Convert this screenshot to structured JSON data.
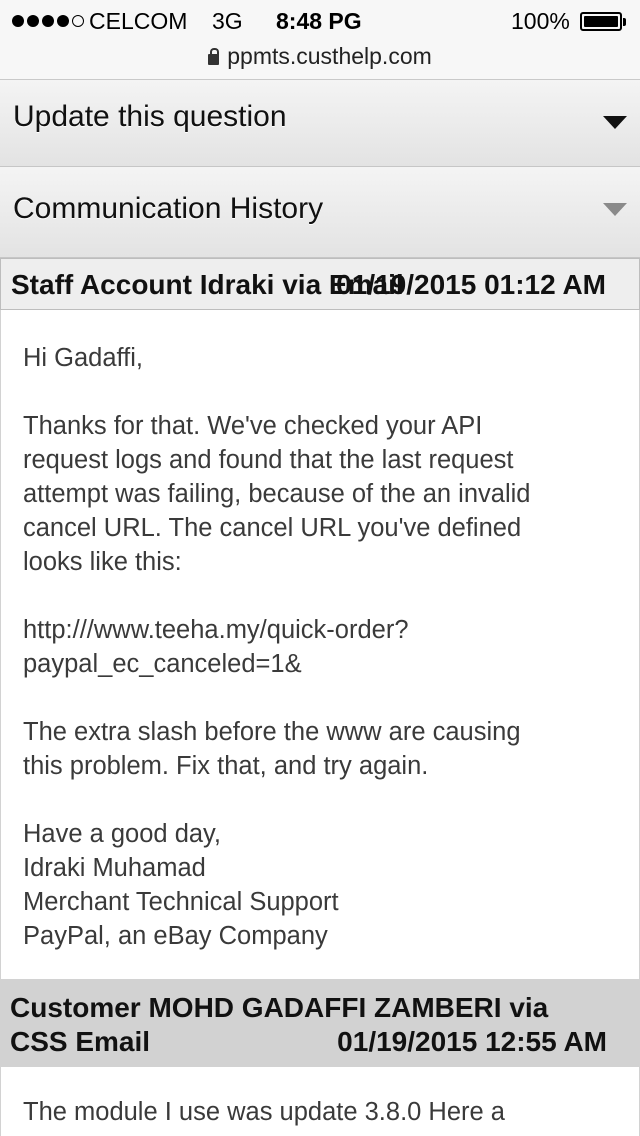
{
  "status_bar": {
    "carrier": "CELCOM",
    "network": "3G",
    "time": "8:48 PG",
    "battery": "100%",
    "url": "ppmts.custhelp.com"
  },
  "sections": {
    "update_question": "Update this question",
    "communication_history": "Communication History"
  },
  "thread": [
    {
      "author": "Staff Account Idraki via Email",
      "date": "01/19/2015 01:12 AM",
      "body": {
        "greeting": "Hi Gadaffi,",
        "p1": [
          "Thanks for that. We've checked your API",
          "request logs and found that the last request",
          "attempt was failing, because of the an invalid",
          "cancel URL. The cancel URL you've defined",
          "looks like this:"
        ],
        "url": [
          "http:///www.teeha.my/quick-order?",
          "paypal_ec_canceled=1&"
        ],
        "p2": [
          "The extra slash before the www are causing",
          "this problem. Fix that, and try again."
        ],
        "signature": [
          "Have a good day,",
          "Idraki Muhamad",
          "Merchant Technical Support",
          "PayPal, an eBay Company"
        ]
      }
    },
    {
      "author_line1": "Customer MOHD GADAFFI ZAMBERI via",
      "author_line2": "CSS Email",
      "date": "01/19/2015 12:55 AM",
      "body_line1": "The module I use was update 3.8.0 Here a"
    }
  ]
}
